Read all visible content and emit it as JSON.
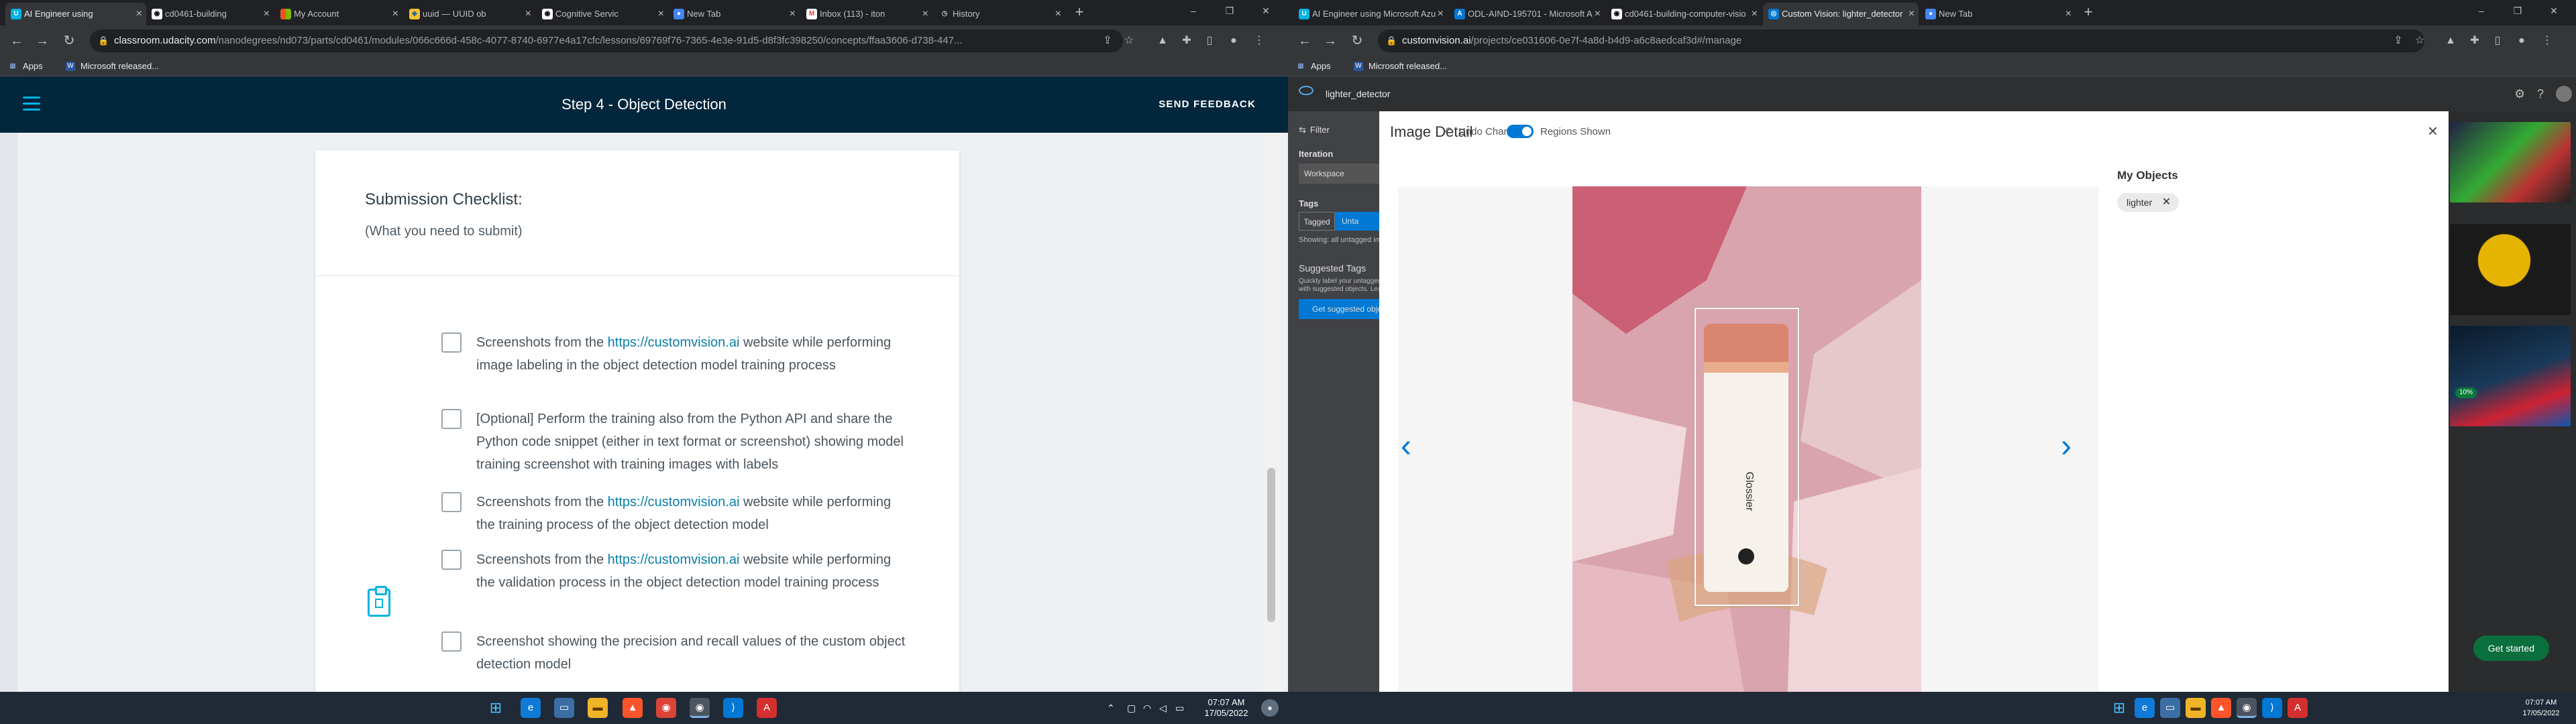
{
  "left": {
    "tabs": [
      {
        "label": "AI Engineer using",
        "active": true,
        "icon": "udacity-icon"
      },
      {
        "label": "cd0461-building",
        "icon": "github-icon"
      },
      {
        "label": "My Account",
        "icon": "microsoft-icon"
      },
      {
        "label": "uuid — UUID ob",
        "icon": "python-icon"
      },
      {
        "label": "Cognitive Servic",
        "icon": "github-icon"
      },
      {
        "label": "New Tab",
        "icon": "chrome-icon"
      },
      {
        "label": "Inbox (113) - iton",
        "icon": "gmail-icon"
      },
      {
        "label": "History",
        "icon": "history-icon"
      }
    ],
    "url_host": "classroom.udacity.com",
    "url_path": "/nanodegrees/nd073/parts/cd0461/modules/066c666d-458c-4077-8740-6977e4a17cfc/lessons/69769f76-7365-4e3e-91d5-d8f3fc398250/concepts/ffaa3606-d738-447...",
    "bookmarks": [
      "Apps",
      "Microsoft released..."
    ],
    "page": {
      "title": "Step 4 - Object Detection",
      "feedback": "SEND FEEDBACK",
      "checklist_title": "Submission Checklist:",
      "checklist_sub": "(What you need to submit)",
      "items": [
        {
          "pre": "Screenshots from the ",
          "link": "https://customvision.ai",
          "post": " website while performing image labeling in the object detection model training process"
        },
        {
          "pre": "[Optional] Perform the training also from the Python API and share the Python code snippet (either in text format or screenshot) showing model training screenshot with training images with labels",
          "link": "",
          "post": ""
        },
        {
          "pre": "Screenshots from the ",
          "link": "https://customvision.ai",
          "post": " website while performing the training process of the object detection model"
        },
        {
          "pre": "Screenshots from the ",
          "link": "https://customvision.ai",
          "post": " website while performing the validation process in the object detection model training process"
        },
        {
          "pre": "Screenshot showing the precision and recall values of the custom object detection model",
          "link": "",
          "post": ""
        }
      ]
    },
    "clock": {
      "time": "07:07 AM",
      "date": "17/05/2022"
    }
  },
  "right": {
    "tabs": [
      {
        "label": "AI Engineer using Microsoft Azu",
        "icon": "udacity-icon"
      },
      {
        "label": "ODL-AIND-195701 - Microsoft A",
        "icon": "azure-icon"
      },
      {
        "label": "cd0461-building-computer-visio",
        "icon": "github-icon"
      },
      {
        "label": "Custom Vision: lighter_detector",
        "active": true,
        "icon": "customvision-icon"
      },
      {
        "label": "New Tab",
        "icon": "chrome-icon"
      }
    ],
    "url_host": "customvision.ai",
    "url_path": "/projects/ce031606-0e7f-4a8d-b4d9-a6c8aedcaf3d#/manage",
    "bookmarks": [
      "Apps",
      "Microsoft released..."
    ],
    "project": "lighter_detector",
    "sidebar": {
      "filter": "Filter",
      "iteration": "Iteration",
      "workspace": "Workspace",
      "tags": "Tags",
      "tagged": "Tagged",
      "untagged": "Unta",
      "showing": "Showing: all untagged ima",
      "suggested": "Suggested Tags",
      "suggested_desc": "Quickly label your untagged with suggested objects. Lea",
      "suggested_btn": "Get suggested obje"
    },
    "modal": {
      "title": "Image Detail",
      "undo": "Undo Changes",
      "regions": "Regions Shown",
      "my_objects": "My Objects",
      "tag": "lighter",
      "product_text": "Glossier"
    },
    "progress_badge": "10%",
    "get_started": "Get started",
    "clock": {
      "time": "07:07 AM",
      "date": "17/05/2022"
    }
  }
}
